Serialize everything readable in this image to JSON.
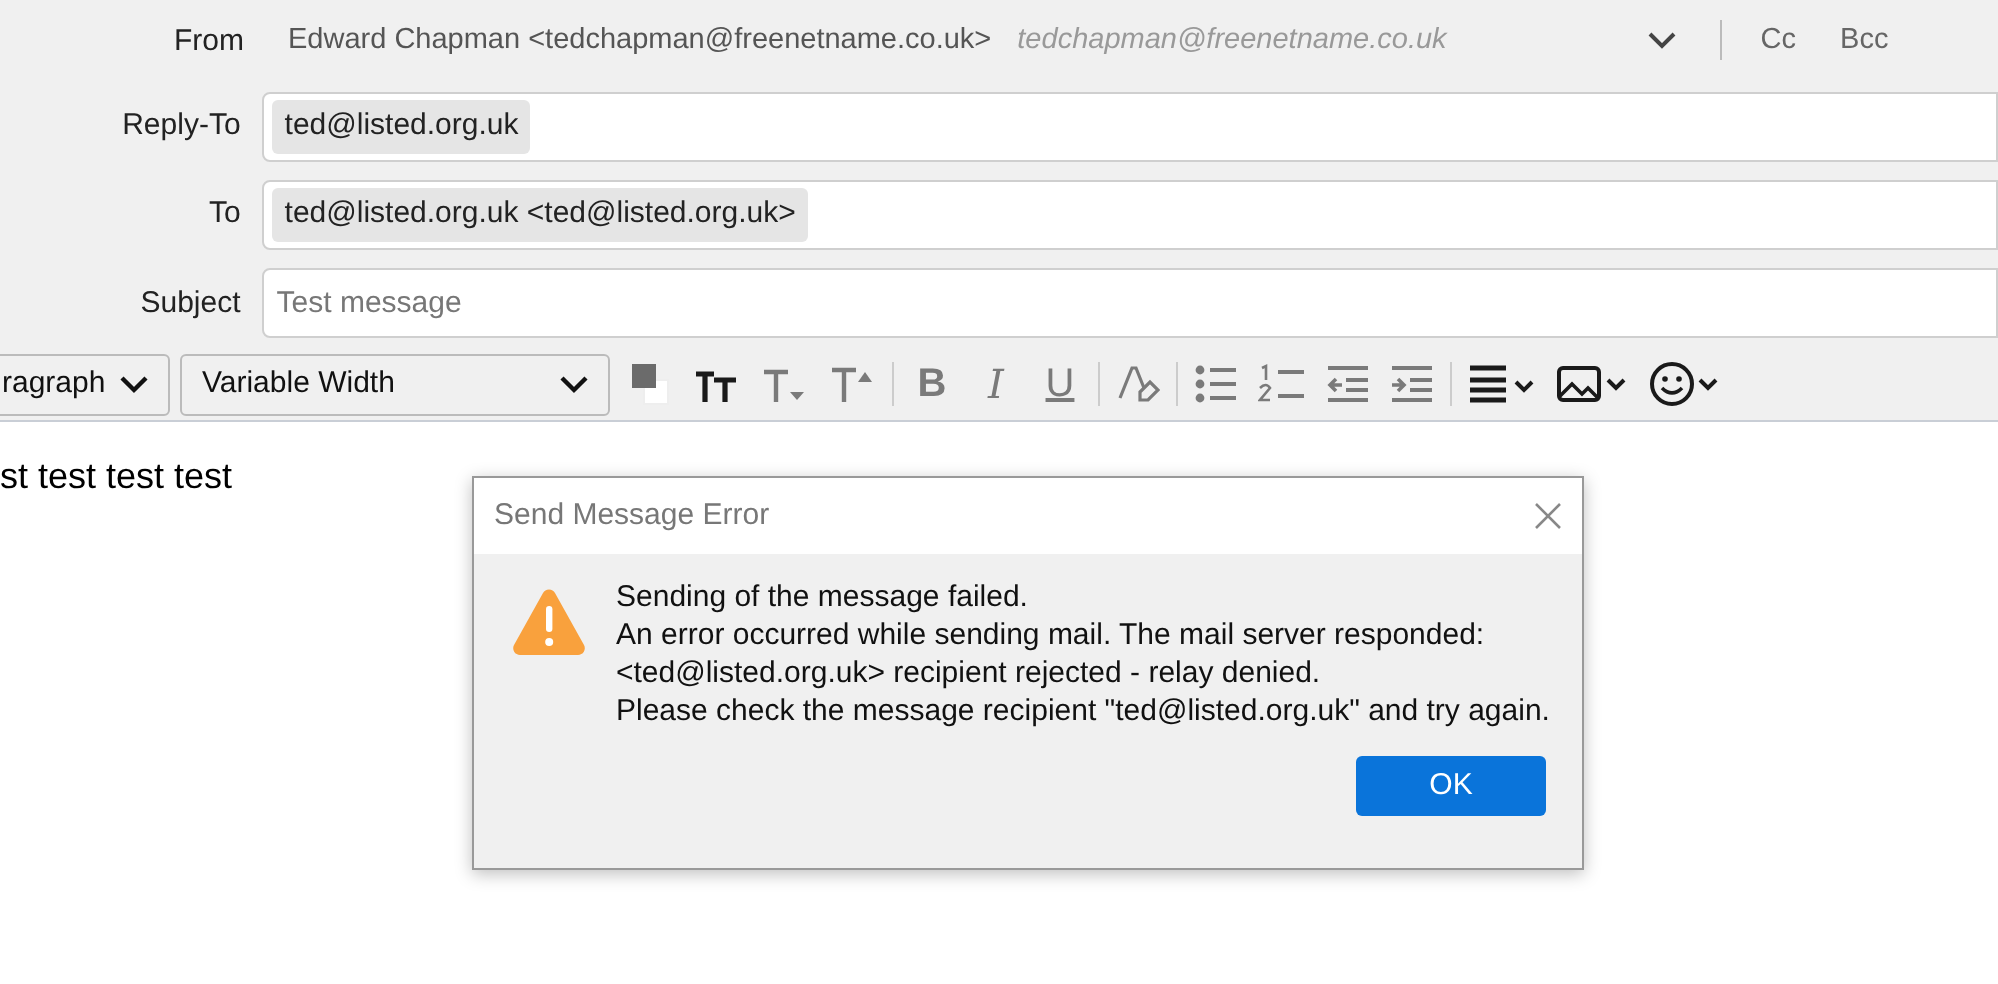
{
  "from": {
    "label": "From",
    "identity": "Edward Chapman <tedchapman@freenetname.co.uk>",
    "address": "tedchapman@freenetname.co.uk",
    "cc": "Cc",
    "bcc": "Bcc"
  },
  "fields": [
    {
      "label": "Reply-To",
      "pills": [
        "ted@listed.org.uk"
      ]
    },
    {
      "label": "To",
      "pills": [
        "ted@listed.org.uk <ted@listed.org.uk>"
      ]
    }
  ],
  "subject": {
    "label": "Subject",
    "placeholder": "Test message"
  },
  "toolbar": {
    "paragraph": "ragraph",
    "font": "Variable Width",
    "buttons": [
      {
        "kind": "color"
      },
      {
        "kind": "heading"
      },
      {
        "kind": "smaller"
      },
      {
        "kind": "larger"
      },
      {
        "kind": "sep"
      },
      {
        "kind": "bold",
        "glyph": "B"
      },
      {
        "kind": "italic",
        "glyph": "I"
      },
      {
        "kind": "underline",
        "glyph": "U"
      },
      {
        "kind": "sep"
      },
      {
        "kind": "clear"
      },
      {
        "kind": "sep"
      },
      {
        "kind": "bullets"
      },
      {
        "kind": "numbers"
      },
      {
        "kind": "outdent"
      },
      {
        "kind": "indent"
      },
      {
        "kind": "sep"
      },
      {
        "kind": "align"
      },
      {
        "kind": "image"
      },
      {
        "kind": "emoji"
      }
    ]
  },
  "body": "st test test test",
  "dialog": {
    "title": "Send Message Error",
    "lines": [
      "Sending of the message failed.",
      "An error occurred while sending mail. The mail server responded:",
      "<ted@listed.org.uk> recipient rejected - relay denied.",
      "Please check the message recipient \"ted@listed.org.uk\" and try again."
    ],
    "button": "OK"
  }
}
